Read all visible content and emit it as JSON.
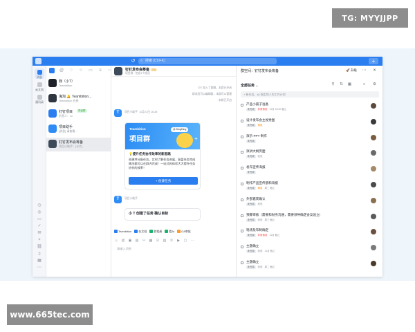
{
  "watermarks": {
    "top": "TG: MYYJJPP",
    "bottom": "www.665tec.com"
  },
  "titlebar": {
    "search_placeholder": "搜索 (Ctrl+K)",
    "history_icon": "history-icon",
    "plus_label": "+"
  },
  "rail": {
    "items": [
      {
        "label": "消息",
        "icon": "chat-icon",
        "active": true
      },
      {
        "label": "云文档",
        "icon": "doc-icon",
        "active": false
      },
      {
        "label": "通讯录",
        "icon": "contacts-icon",
        "active": false
      }
    ],
    "bottom_icons": [
      "calendar-icon",
      "globe-icon",
      "folder-icon",
      "check-icon",
      "mail-icon",
      "tag-icon",
      "link-icon",
      "device-icon",
      "grid-icon",
      "more-icon"
    ]
  },
  "chat_list": {
    "items": [
      {
        "name": "我（小T）",
        "sub": "Teambition",
        "avatar_color": "#1f2329"
      },
      {
        "name": "海淘 🔔 Teambition...",
        "sub": "Teambition 在线",
        "avatar_color": "#2f3640"
      },
      {
        "name": "钉钉项目",
        "tag": "项目群",
        "sub": "负责人：xx",
        "avatar_color": "#2a7ef0"
      },
      {
        "name": "项目助手",
        "sub": "[消息] 请查看...",
        "avatar_color": "#2f8cf5"
      },
      {
        "name": "钉钉发布会筹备",
        "sub": "项目小助手：[卡片]",
        "avatar_color": "#3d4a5a",
        "active": true
      }
    ]
  },
  "chat": {
    "title": "钉钉发布会筹备",
    "title_tag": "项目",
    "subtitle": "项目群 · 包含1个成员",
    "system_msgs": [
      "小T 加入了群聊，本群已开启",
      "群成员可以编辑群，本群可以管理",
      "本群已开启"
    ],
    "bot_name": "项目小助手",
    "bot_time": "11月21日 16:28",
    "card": {
      "logo": "Teambition",
      "banner_title": "项目群",
      "pill": "@ DingDing",
      "heading": "提升任务协作效率的新思路",
      "body": "创建并分配任务，实时了解任务进展，复盘任务完成情况都可以在群内完成！一站式的体验大大提升任务协作的效率！",
      "button": "+ 创建任务"
    },
    "bot2_name": "项目小助手",
    "card2_title": "小 T 创建了任务 确认目标",
    "apps": [
      {
        "label": "Teambition",
        "color": "#2a7ef0"
      },
      {
        "label": "在文档",
        "color": "#2a7ef0"
      },
      {
        "label": "群相册",
        "color": "#19b26b"
      },
      {
        "label": "看AI",
        "color": "#19b26b"
      },
      {
        "label": "OA审批",
        "color": "#ff9a2e"
      }
    ],
    "input_placeholder": "请输入消息"
  },
  "panel": {
    "title": "群空间：钉钉发布会筹备",
    "upgrade": "升级",
    "filter": "全部任务",
    "new_task_placeholder": "+ 新任务，@ 指定到人的工作计划",
    "tasks": [
      {
        "title": "产品小册子准备",
        "tag": "未完成",
        "priority": "非常紧急",
        "pri_color": "#f54a45",
        "due": "11月 18:00 截止"
      },
      {
        "title": "设计发布会主视觉图",
        "tag": "未完成",
        "priority": "紧急",
        "pri_color": "#ff8800",
        "due": ""
      },
      {
        "title": "演示 PPT 制作",
        "tag": "未完成",
        "priority": "",
        "pri_color": "",
        "due": ""
      },
      {
        "title": "演讲大纲页面",
        "tag": "未完成",
        "priority": "较低",
        "pri_color": "#8f959e",
        "due": ""
      },
      {
        "title": "发布宣传海报",
        "tag": "未完成",
        "priority": "",
        "pri_color": "",
        "due": ""
      },
      {
        "title": "制作产品宣传册和海报",
        "tag": "未完成",
        "priority": "紧急",
        "pri_color": "#ff8800",
        "due": "周二 截止"
      },
      {
        "title": "外部嘉宾确认",
        "tag": "未完成",
        "priority": "较低",
        "pri_color": "#8f959e",
        "due": ""
      },
      {
        "title": "预算审核（需要和财务沟通，需要领导确定会议设立）",
        "tag": "未完成",
        "priority": "较低",
        "pri_color": "#8f959e",
        "due": "周三 截止"
      },
      {
        "title": "现场及布制确定",
        "tag": "未完成",
        "priority": "非常紧急",
        "pri_color": "#f54a45",
        "due": "11月 截止"
      },
      {
        "title": "主题确立",
        "tag": "未完成",
        "priority": "较低",
        "pri_color": "#8f959e",
        "due": "11月 截止"
      },
      {
        "title": "主题确立",
        "tag": "未完成",
        "priority": "较低",
        "pri_color": "#8f959e",
        "due": "周二 截止"
      }
    ]
  }
}
